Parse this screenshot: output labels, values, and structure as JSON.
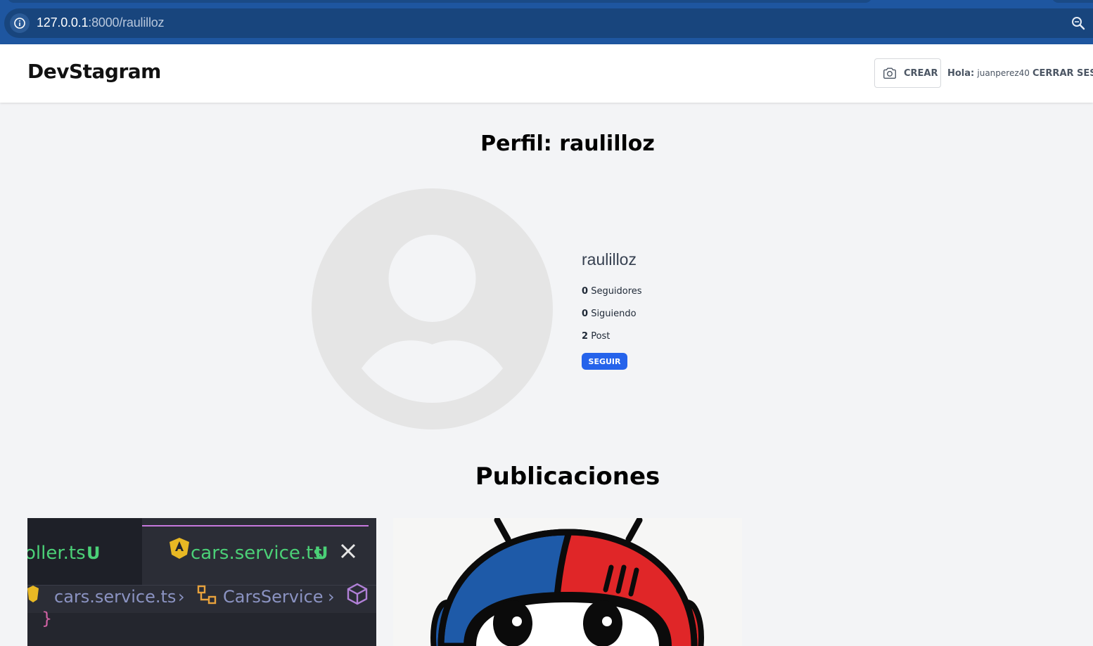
{
  "browser": {
    "url_host": "127.0.0.1",
    "url_path": ":8000/raulilloz"
  },
  "header": {
    "logo": "DevStagram",
    "create_label": "CREAR",
    "greeting_prefix": "Hola:",
    "greeting_user": "juanperez40",
    "logout_label": "CERRAR SESI"
  },
  "profile": {
    "title": "Perfil: raulilloz",
    "username": "raulilloz",
    "followers_count": "0",
    "followers_label": "Seguidores",
    "following_count": "0",
    "following_label": "Siguiendo",
    "posts_count": "2",
    "posts_label": "Post",
    "follow_label": "SEGUIR"
  },
  "posts": {
    "title": "Publicaciones",
    "post1": {
      "tab1": "oller.ts",
      "tab1_status": "U",
      "tab2": "cars.service.ts",
      "tab2_status": "U",
      "crumb1": "cars.service.ts",
      "crumb2": "CarsService",
      "brace": "}"
    }
  },
  "colors": {
    "accent": "#2563eb",
    "page_bg": "#f3f4f6",
    "chrome": "#1e56a0"
  }
}
